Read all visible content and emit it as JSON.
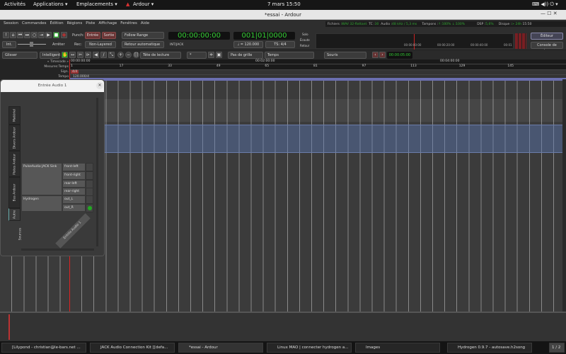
{
  "topbar": {
    "activities": "Activités",
    "applications": "Applications ▾",
    "places": "Emplacements ▾",
    "app": "Ardour ▾",
    "clock": "7 mars  15:50",
    "icons": "⌨ ◀)) ⏻ ▾"
  },
  "window": {
    "title": "*essai - Ardour"
  },
  "menu": [
    "Session",
    "Commandes",
    "Édition",
    "Régions",
    "Piste",
    "Affichage",
    "Fenêtres",
    "Aide"
  ],
  "transport": {
    "punch_label": "Punch:",
    "punch_in": "Entrée",
    "punch_out": "Sortie",
    "rec_label": "Rec:",
    "rec_mode": "Non-Layered",
    "follow_range": "Follow Range",
    "auto_return": "Retour automatique",
    "int": "Int.",
    "stop_label": "Arrêter",
    "primary_clock": "00:00:00:00",
    "primary_source": "INT/JACK",
    "secondary_clock": "001|01|0000",
    "tempo": "♩ = 120.000",
    "meter": "TS: 4/4",
    "solo": "Solo",
    "listen": "Écoute",
    "return": "Retour"
  },
  "status": {
    "files_label": "Fichiers :",
    "files": "WAV 32-flottant",
    "tc_label": "TC :",
    "tc": "30",
    "audio_label": "Audio :",
    "audio": "48 kHz / 5,3 ms",
    "buffers_label": "Tampons :",
    "buffers": "↑:100% ↓:100%",
    "dsp_label": "DSP :",
    "dsp": "5,6%",
    "disk_label": "Disque :",
    "disk": "> 24h",
    "time": "15:50"
  },
  "minitimeline": {
    "labels": [
      "00:00:00:00",
      "00:00:20:00",
      "00:00:40:00",
      "00:01"
    ]
  },
  "buttons": {
    "editor": "Éditeur",
    "mixer": "Console de mixage"
  },
  "editbar": {
    "edit_mode": "Glisser",
    "ripple": "Intelligent",
    "edit_point": "Tête de lecture",
    "zoom": "*",
    "grid": "Pas de grille",
    "grid_type": "Temps",
    "mouse": "Souris",
    "nudge_clock": "00:00:05:00"
  },
  "rulers": {
    "timecode_label": "« Timecode »",
    "bbt_label": "Mesures:Temps",
    "meter_label": "Sign.",
    "tempo_label": "Tempo",
    "timecode_marks": [
      "00:00:00:00",
      "00:02:00:00",
      "00:04:00:00"
    ],
    "bars": [
      "1",
      "17",
      "33",
      "49",
      "65",
      "81",
      "97",
      "113",
      "129",
      "145"
    ],
    "meter_marker": "4/4",
    "tempo_marker": "120.000/4"
  },
  "dialog": {
    "title": "Entrée Audio 1",
    "tabs": [
      "Matériel",
      "Divers Ardour",
      "Pistes Ardour",
      "Bus Ardour",
      "Autre"
    ],
    "sources_label": "Sources",
    "destination": "Entrée Audio 1",
    "clients": [
      {
        "name": "PulseAudio JACK Sink",
        "ports": [
          "front-left",
          "front-right",
          "rear-left",
          "rear-right"
        ]
      },
      {
        "name": "Hydrogen",
        "ports": [
          "out_L",
          "out_R"
        ]
      }
    ],
    "connected_port": "out_R",
    "connected_color": "#22aa22"
  },
  "taskbar": {
    "items": [
      "[Lilypond - christian@le-bars.net ...",
      "JACK Audio Connection Kit [[defa...",
      "*essai - Ardour",
      "Linux MAO | connecter hydrogen a...",
      "Images",
      "Hydrogen 0.9.7 - autosave.h2song"
    ],
    "workspace": "1 / 2"
  },
  "colors": {
    "clock_green": "#33cc33",
    "playhead": "#dd2222",
    "track_blue": "#4d5f80"
  }
}
